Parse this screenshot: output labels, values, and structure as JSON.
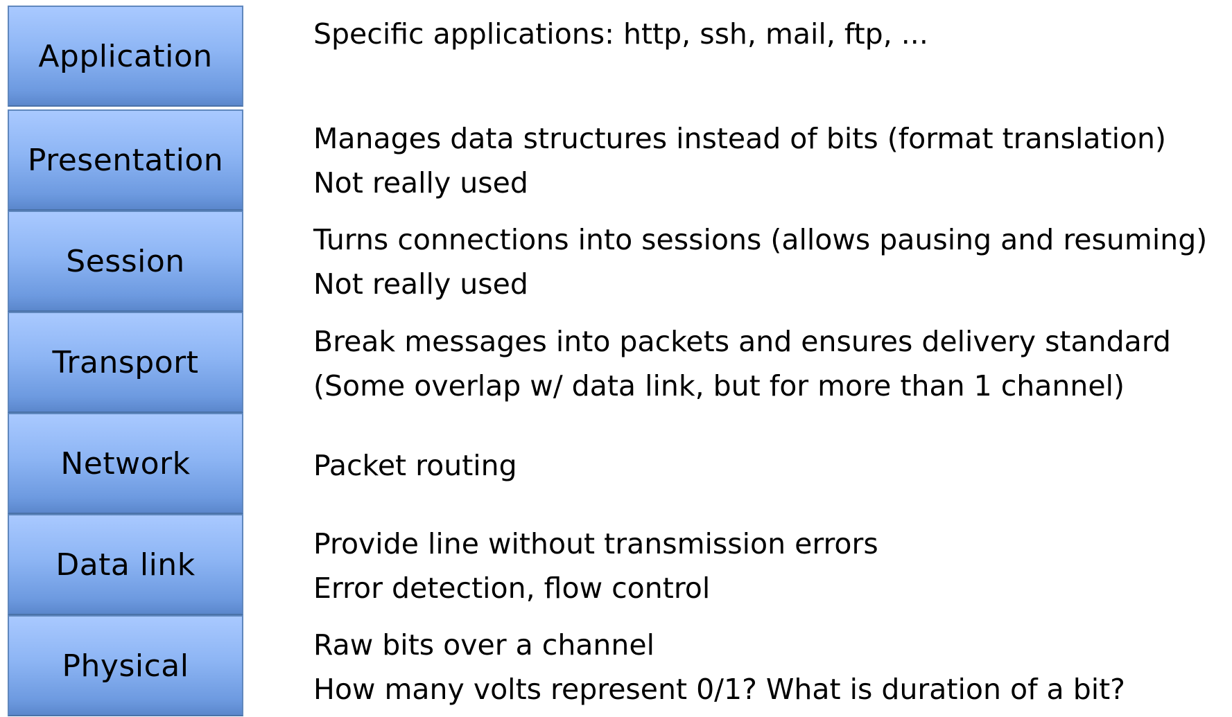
{
  "layers": [
    {
      "name": "Application",
      "lines": [
        "Specific applications: http, ssh, mail, ftp, ..."
      ]
    },
    {
      "name": "Presentation",
      "lines": [
        "Manages data structures instead of bits (format translation)",
        "Not really used"
      ]
    },
    {
      "name": "Session",
      "lines": [
        "Turns connections into sessions (allows pausing and resuming)",
        "Not really used"
      ]
    },
    {
      "name": "Transport",
      "lines": [
        "Break messages into packets and ensures delivery standard",
        "(Some overlap w/ data link, but for more than 1 channel)"
      ]
    },
    {
      "name": "Network",
      "lines": [
        "Packet routing"
      ]
    },
    {
      "name": "Data link",
      "lines": [
        "Provide line without transmission errors",
        "Error detection, flow control"
      ]
    },
    {
      "name": "Physical",
      "lines": [
        "Raw bits over a channel",
        "How many volts represent 0/1?  What is duration of a bit?"
      ]
    }
  ]
}
